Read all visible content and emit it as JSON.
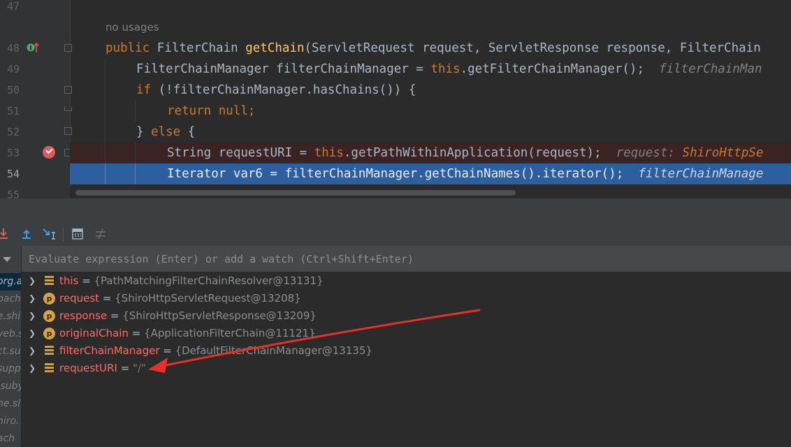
{
  "editor": {
    "line_numbers": [
      "47",
      "48",
      "49",
      "50",
      "51",
      "52",
      "53",
      "54",
      "55"
    ],
    "usages_hint": "no usages",
    "lines": {
      "l48": {
        "kw": "public ",
        "t1": "FilterChain ",
        "fn": "getChain",
        "t2": "(ServletRequest request, ServletResponse response, FilterChain"
      },
      "l49": {
        "t1": "FilterChainManager filterChainManager = ",
        "kw": "this",
        "t2": ".getFilterChainManager();",
        "inlay": "filterChainMan"
      },
      "l50": {
        "kw": "if ",
        "t1": "(!filterChainManager.hasChains()) {"
      },
      "l51": {
        "kw": "return null;"
      },
      "l52": {
        "t1": "} ",
        "kw": "else ",
        "t2": "{"
      },
      "l53": {
        "t1": "String requestURI = ",
        "kw": "this",
        "t2": ".getPathWithinApplication(request);",
        "inlay": "request: ",
        "inlay_val": "ShiroHttpSe"
      },
      "l54": {
        "t1": "Iterator var6 = filterChainManager.getChainNames().iterator();",
        "inlay": "filterChainManage"
      }
    }
  },
  "toolbar": {
    "icons": [
      "force-step-into-icon",
      "step-out-icon",
      "run-to-cursor-icon",
      "evaluate-expression-icon",
      "trace-stream-icon"
    ]
  },
  "frames": {
    "items": [
      "org.a",
      "pach",
      "e.shi",
      "veb.s",
      "ct.su",
      "supp",
      ".suby",
      "he.sl",
      "hiro.",
      "ach"
    ]
  },
  "evaluate": {
    "placeholder": "Evaluate expression (Enter) or add a watch (Ctrl+Shift+Enter)"
  },
  "variables": [
    {
      "kind": "field",
      "name": "this",
      "eq": " = ",
      "value": "{PathMatchingFilterChainResolver@13131}"
    },
    {
      "kind": "param",
      "name": "request",
      "eq": " = ",
      "value": "{ShiroHttpServletRequest@13208}"
    },
    {
      "kind": "param",
      "name": "response",
      "eq": " = ",
      "value": "{ShiroHttpServletResponse@13209}"
    },
    {
      "kind": "param",
      "name": "originalChain",
      "eq": " = ",
      "value": "{ApplicationFilterChain@11121}"
    },
    {
      "kind": "field",
      "name": "filterChainManager",
      "eq": " = ",
      "value": "{DefaultFilterChainManager@13135}"
    },
    {
      "kind": "field",
      "name": "requestURI",
      "eq": " = ",
      "value": "\"/\""
    }
  ],
  "colors": {
    "keyword": "#cc7832",
    "method": "#ffc66d",
    "exec_line": "#2d5f9e",
    "breakpoint": "#db5c5c",
    "annotation_arrow": "#e8302a"
  }
}
